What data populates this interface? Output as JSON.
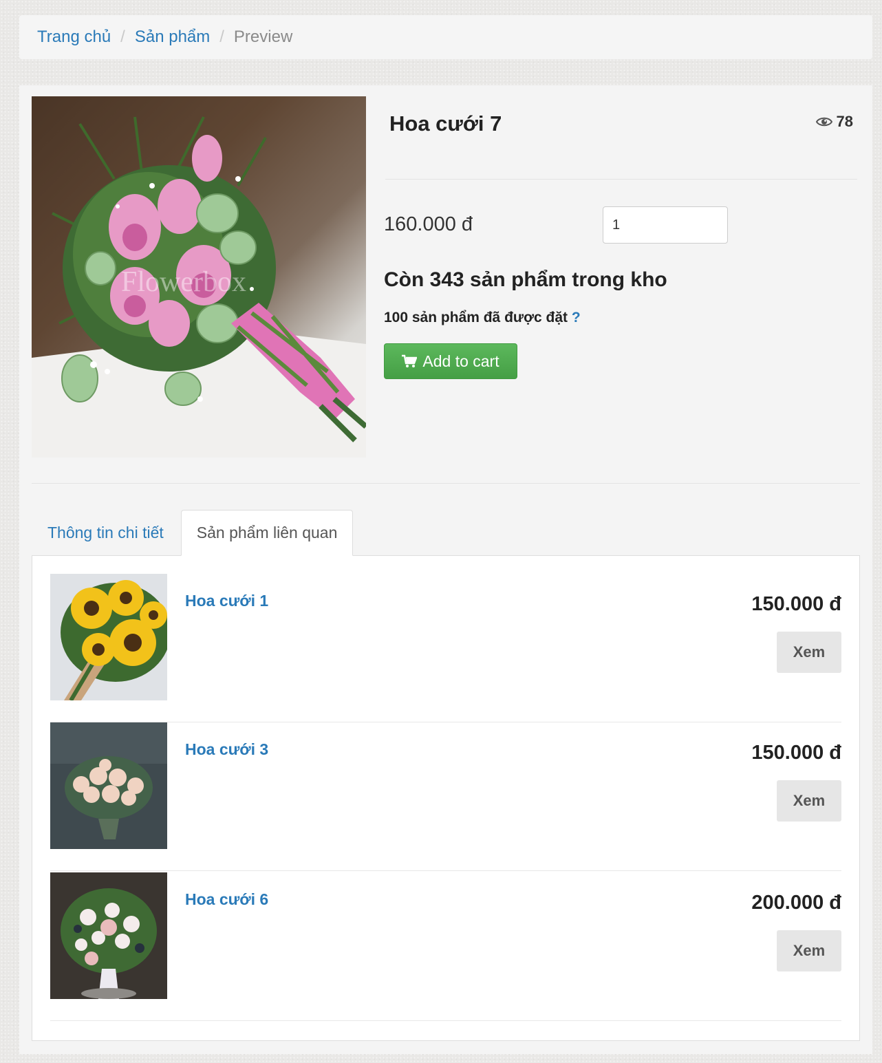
{
  "breadcrumb": {
    "home": "Trang chủ",
    "products": "Sản phẩm",
    "current": "Preview",
    "separator": "/"
  },
  "product": {
    "title": "Hoa cưới 7",
    "views": "78",
    "price": "160.000 đ",
    "quantity": "1",
    "stock_text": "Còn 343 sản phẩm trong kho",
    "ordered_text": "100 sản phẩm đã được đặt",
    "ordered_help": "?",
    "add_to_cart": "Add to cart",
    "watermark": "Flowerbox"
  },
  "tabs": [
    {
      "label": "Thông tin chi tiết",
      "active": false
    },
    {
      "label": "Sản phẩm liên quan",
      "active": true
    }
  ],
  "related": [
    {
      "name": "Hoa cưới 1",
      "price": "150.000 đ",
      "button": "Xem"
    },
    {
      "name": "Hoa cưới 3",
      "price": "150.000 đ",
      "button": "Xem"
    },
    {
      "name": "Hoa cưới 6",
      "price": "200.000 đ",
      "button": "Xem"
    }
  ],
  "colors": {
    "link": "#2a7ab8",
    "success": "#5cb85c",
    "panel": "#f4f4f4"
  },
  "icons": {
    "views": "eye-icon",
    "cart": "shopping-cart-icon"
  }
}
